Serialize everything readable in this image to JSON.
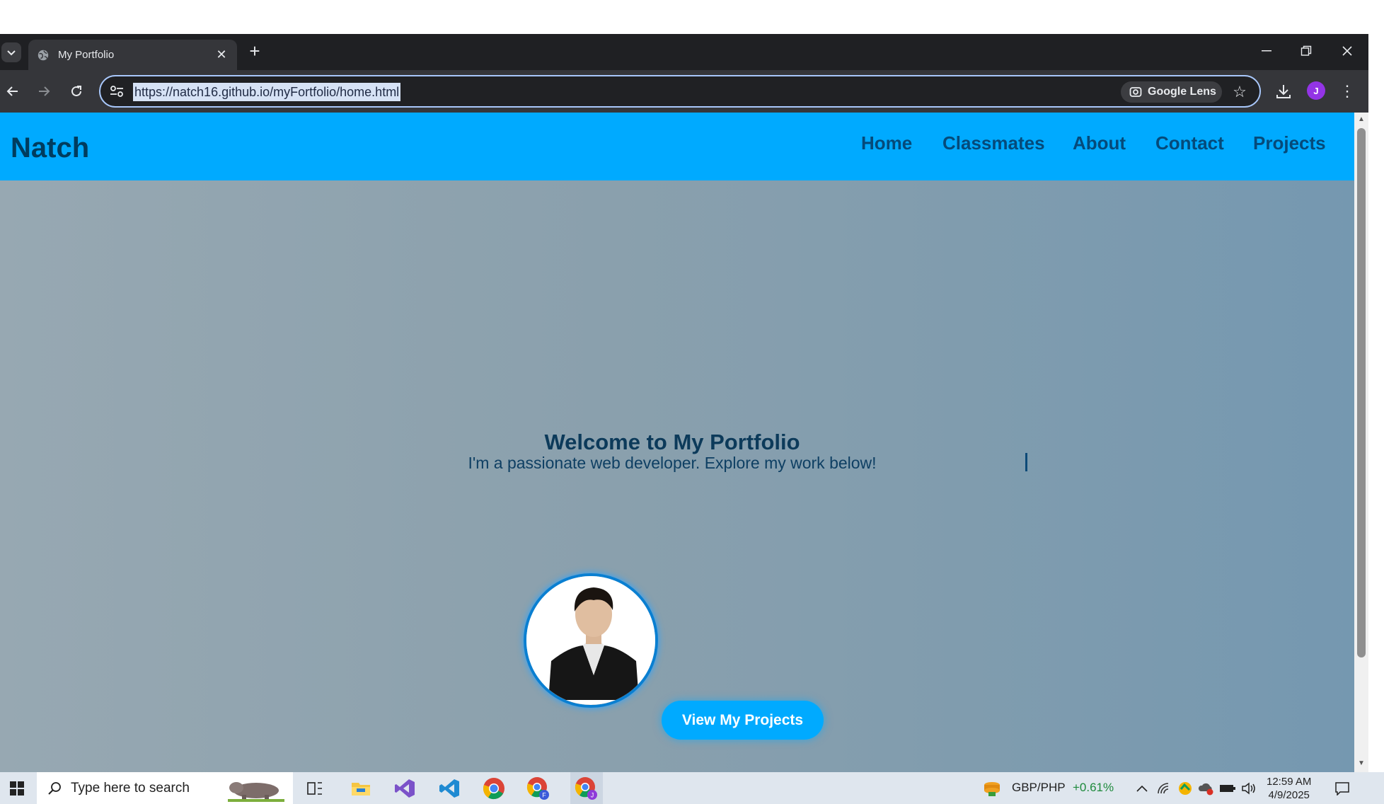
{
  "browser": {
    "tab_title": "My Portfolio",
    "url": "https://natch16.github.io/myFortfolio/home.html",
    "lens_label": "Google Lens",
    "profile_initial": "J"
  },
  "site": {
    "brand": "Natch",
    "nav": [
      {
        "label": "Home"
      },
      {
        "label": "Classmates"
      },
      {
        "label": "About"
      },
      {
        "label": "Contact"
      },
      {
        "label": "Projects"
      }
    ],
    "hero": {
      "title": "Welcome to My Portfolio",
      "subtitle": "I'm a passionate web developer. Explore my work below!",
      "cta": "View My Projects"
    },
    "colors": {
      "header": "#00aaff",
      "accent": "#00aaff",
      "nav_text": "#054a7a"
    }
  },
  "taskbar": {
    "search_placeholder": "Type here to search",
    "ticker_symbol": "GBP/PHP",
    "ticker_change": "+0.61%",
    "time": "12:59 AM",
    "date": "4/9/2025",
    "apps": [
      "task-view-icon",
      "file-explorer-icon",
      "visual-studio-icon",
      "vscode-icon",
      "chrome-icon",
      "chrome-profile-f-icon",
      "chrome-profile-j-icon"
    ]
  }
}
